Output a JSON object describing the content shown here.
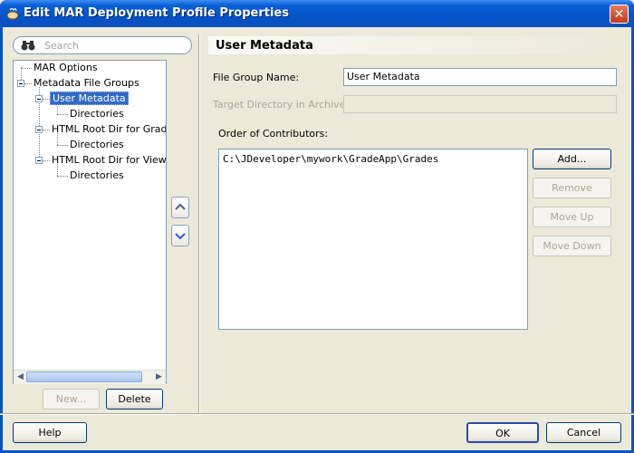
{
  "window": {
    "title": "Edit MAR Deployment Profile Properties",
    "close_label": "✕"
  },
  "search": {
    "placeholder": "Search"
  },
  "tree": {
    "items": [
      {
        "label": "MAR Options"
      },
      {
        "label": "Metadata File Groups"
      },
      {
        "label": "User Metadata",
        "selected": true
      },
      {
        "label": "Directories"
      },
      {
        "label": "HTML Root Dir for Grades"
      },
      {
        "label": "Directories"
      },
      {
        "label": "HTML Root Dir for ViewCor"
      },
      {
        "label": "Directories"
      }
    ]
  },
  "tree_buttons": {
    "new_label": "New...",
    "delete_label": "Delete"
  },
  "section": {
    "title": "User Metadata"
  },
  "form": {
    "file_group_name_label": "File Group Name:",
    "file_group_name_value": "User Metadata",
    "target_dir_label": "Target Directory in Archive:",
    "target_dir_value": "",
    "order_label": "Order of Contributors:",
    "contributors": [
      "C:\\JDeveloper\\mywork\\GradeApp\\Grades"
    ]
  },
  "side_buttons": {
    "add": "Add...",
    "remove": "Remove",
    "move_up": "Move Up",
    "move_down": "Move Down"
  },
  "footer": {
    "help": "Help",
    "ok": "OK",
    "cancel": "Cancel"
  }
}
